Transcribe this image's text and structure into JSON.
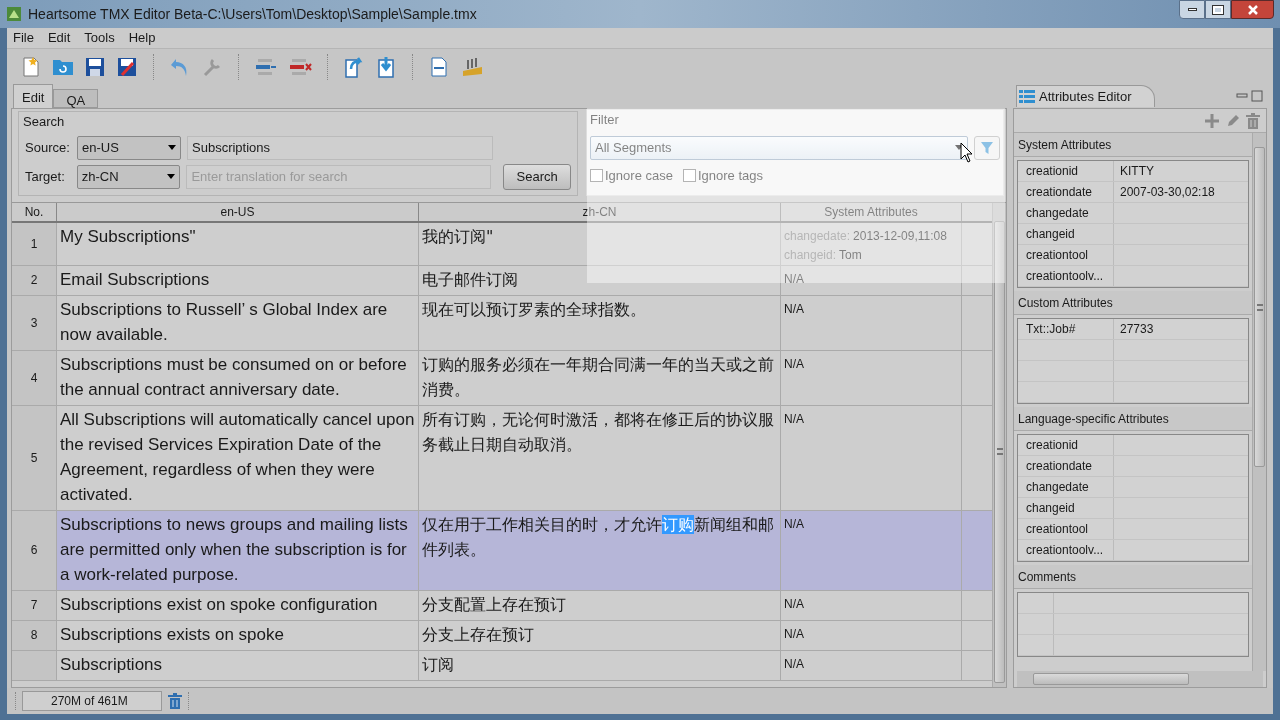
{
  "window": {
    "title": "Heartsome TMX Editor Beta-C:\\Users\\Tom\\Desktop\\Sample\\Sample.tmx"
  },
  "menu": [
    "File",
    "Edit",
    "Tools",
    "Help"
  ],
  "tabs": [
    {
      "label": "Edit",
      "selected": true
    },
    {
      "label": "QA",
      "selected": false
    }
  ],
  "search": {
    "title": "Search",
    "source_label": "Source:",
    "source_lang": "en-US",
    "source_value": "Subscriptions",
    "target_label": "Target:",
    "target_lang": "zh-CN",
    "target_placeholder": "Enter translation for search",
    "button": "Search"
  },
  "filter": {
    "title": "Filter",
    "value": "All Segments",
    "options": [
      {
        "label": "Ignore case",
        "checked": false
      },
      {
        "label": "Ignore tags",
        "checked": false
      }
    ]
  },
  "table": {
    "columns": [
      "No.",
      "en-US",
      "zh-CN",
      "System Attributes"
    ],
    "rows": [
      {
        "no": "1",
        "en": "My Subscriptions\"",
        "zh": "我的订阅\"",
        "selected": false,
        "attributes": [
          {
            "name": "changedate:",
            "value": "2013-12-09,11:08"
          },
          {
            "name": "changeid:",
            "value": "Tom"
          }
        ]
      },
      {
        "no": "2",
        "en": "Email Subscriptions",
        "zh": "电子邮件订阅",
        "selected": false,
        "note": "N/A"
      },
      {
        "no": "3",
        "en": "Subscriptions to Russell’ s Global Index are now available.",
        "zh": "现在可以预订罗素的全球指数。",
        "selected": false,
        "note": "N/A"
      },
      {
        "no": "4",
        "en": "Subscriptions must be consumed on or before the annual contract anniversary date.",
        "zh": "订购的服务必须在一年期合同满一年的当天或之前消费。",
        "selected": false,
        "note": "N/A"
      },
      {
        "no": "5",
        "en": "All Subscriptions will automatically cancel upon the revised Services Expiration Date of the Agreement, regardless of when they were activated.",
        "zh": "所有订购，无论何时激活，都将在修正后的协议服务截止日期自动取消。",
        "selected": false,
        "note": "N/A"
      },
      {
        "no": "6",
        "en": "Subscriptions to news groups and mailing lists are permitted only when the subscription is for a work-related purpose.",
        "zh": [
          {
            "text": "仅在用于工作相关目的时，才允许",
            "selected": false
          },
          {
            "text": "订购",
            "selected": true
          },
          {
            "text": "新闻组和邮件列表。",
            "selected": false
          }
        ],
        "selected": true,
        "note": "N/A"
      },
      {
        "no": "7",
        "en": "Subscriptions exist on spoke configuration",
        "zh": "分支配置上存在预订",
        "selected": false,
        "note": "N/A"
      },
      {
        "no": "8",
        "en": "Subscriptions exists on spoke",
        "zh": "分支上存在预订",
        "selected": false,
        "note": "N/A"
      },
      {
        "en": "Subscriptions",
        "zh": "订阅",
        "selected": false,
        "note": "N/A"
      }
    ]
  },
  "attributes_editor": {
    "title": "Attributes Editor",
    "sections": [
      {
        "title": "System Attributes",
        "rows": [
          {
            "name": "creationid",
            "value": "KITTY"
          },
          {
            "name": "creationdate",
            "value": "2007-03-30,02:18"
          },
          {
            "name": "changedate"
          },
          {
            "name": "changeid"
          },
          {
            "name": "creationtool"
          },
          {
            "name": "creationtoolv..."
          }
        ]
      },
      {
        "title": "Custom Attributes",
        "rows": [
          {
            "name": "Txt::Job#",
            "value": "27733"
          }
        ]
      },
      {
        "title": "Language-specific Attributes",
        "rows": [
          {
            "name": "creationid"
          },
          {
            "name": "creationdate"
          },
          {
            "name": "changedate"
          },
          {
            "name": "changeid"
          },
          {
            "name": "creationtool"
          },
          {
            "name": "creationtoolv..."
          }
        ]
      },
      {
        "title": "Comments"
      }
    ]
  },
  "status_bar": {
    "memory": "270M of 461M"
  }
}
